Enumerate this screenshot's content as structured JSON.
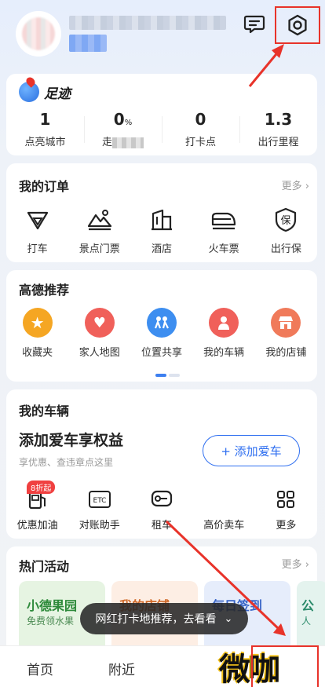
{
  "header": {
    "message_icon": "message-icon",
    "settings_icon": "settings-hexagon-icon"
  },
  "footprint": {
    "title": "足迹",
    "stats": [
      {
        "value": "1",
        "label": "点亮城市"
      },
      {
        "value": "0",
        "label": "走"
      },
      {
        "value": "0",
        "label": "打卡点"
      },
      {
        "value": "1.3",
        "label": "出行里程"
      }
    ]
  },
  "orders": {
    "title": "我的订单",
    "more": "更多",
    "items": [
      {
        "label": "打车",
        "icon": "taxi-icon"
      },
      {
        "label": "景点门票",
        "icon": "scenic-ticket-icon"
      },
      {
        "label": "酒店",
        "icon": "hotel-icon"
      },
      {
        "label": "火车票",
        "icon": "train-icon"
      },
      {
        "label": "出行保",
        "icon": "insurance-icon"
      }
    ]
  },
  "recommend": {
    "title": "高德推荐",
    "items": [
      {
        "label": "收藏夹",
        "icon": "star-icon",
        "color": "#f5a623"
      },
      {
        "label": "家人地图",
        "icon": "family-heart-icon",
        "color": "#f0605a"
      },
      {
        "label": "位置共享",
        "icon": "location-share-icon",
        "color": "#3d8ef0"
      },
      {
        "label": "我的车辆",
        "icon": "my-vehicle-icon",
        "color": "#f0605a"
      },
      {
        "label": "我的店铺",
        "icon": "my-store-icon",
        "color": "#f07a5a"
      }
    ]
  },
  "vehicle": {
    "title": "我的车辆",
    "headline": "添加爱车享权益",
    "subtitle": "享优惠、查违章点这里",
    "add_button": "+ 添加爱车",
    "tools": [
      {
        "label": "优惠加油",
        "icon": "fuel-icon",
        "badge": "8折起"
      },
      {
        "label": "对账助手",
        "icon": "etc-icon",
        "badge": "",
        "icon_text": "ETC"
      },
      {
        "label": "租车",
        "icon": "rent-car-icon",
        "badge": ""
      },
      {
        "label": "高价卖车",
        "icon": "sell-car-icon",
        "badge": ""
      },
      {
        "label": "更多",
        "icon": "grid-more-icon",
        "badge": ""
      }
    ]
  },
  "hot": {
    "title": "热门活动",
    "more": "更多",
    "activities": [
      {
        "title": "小德果园",
        "sub": "免费领水果",
        "color": "#e6f4e2"
      },
      {
        "title": "我的店铺",
        "sub": "",
        "color": "#fdeee4"
      },
      {
        "title": "每日签到",
        "sub": "",
        "color": "#e6edfb"
      },
      {
        "title": "公",
        "sub": "人",
        "color": "#e4f3ee"
      }
    ]
  },
  "toast": {
    "text": "网红打卡地推荐，去看看"
  },
  "tabbar": {
    "tabs": [
      {
        "label": "首页"
      },
      {
        "label": "附近"
      }
    ]
  },
  "watermark": {
    "text": "微咖"
  }
}
